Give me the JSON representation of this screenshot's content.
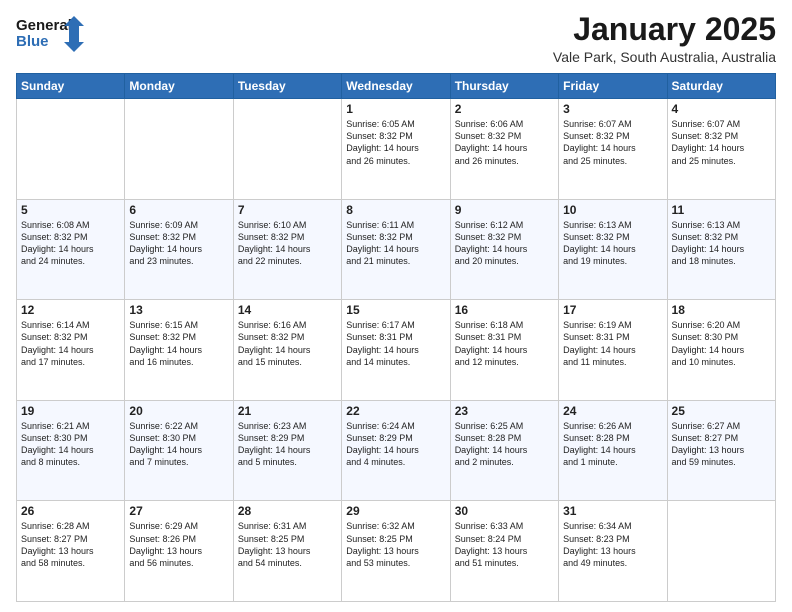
{
  "header": {
    "logo_line1": "General",
    "logo_line2": "Blue",
    "month": "January 2025",
    "location": "Vale Park, South Australia, Australia"
  },
  "days_of_week": [
    "Sunday",
    "Monday",
    "Tuesday",
    "Wednesday",
    "Thursday",
    "Friday",
    "Saturday"
  ],
  "weeks": [
    [
      {
        "day": "",
        "info": ""
      },
      {
        "day": "",
        "info": ""
      },
      {
        "day": "",
        "info": ""
      },
      {
        "day": "1",
        "info": "Sunrise: 6:05 AM\nSunset: 8:32 PM\nDaylight: 14 hours\nand 26 minutes."
      },
      {
        "day": "2",
        "info": "Sunrise: 6:06 AM\nSunset: 8:32 PM\nDaylight: 14 hours\nand 26 minutes."
      },
      {
        "day": "3",
        "info": "Sunrise: 6:07 AM\nSunset: 8:32 PM\nDaylight: 14 hours\nand 25 minutes."
      },
      {
        "day": "4",
        "info": "Sunrise: 6:07 AM\nSunset: 8:32 PM\nDaylight: 14 hours\nand 25 minutes."
      }
    ],
    [
      {
        "day": "5",
        "info": "Sunrise: 6:08 AM\nSunset: 8:32 PM\nDaylight: 14 hours\nand 24 minutes."
      },
      {
        "day": "6",
        "info": "Sunrise: 6:09 AM\nSunset: 8:32 PM\nDaylight: 14 hours\nand 23 minutes."
      },
      {
        "day": "7",
        "info": "Sunrise: 6:10 AM\nSunset: 8:32 PM\nDaylight: 14 hours\nand 22 minutes."
      },
      {
        "day": "8",
        "info": "Sunrise: 6:11 AM\nSunset: 8:32 PM\nDaylight: 14 hours\nand 21 minutes."
      },
      {
        "day": "9",
        "info": "Sunrise: 6:12 AM\nSunset: 8:32 PM\nDaylight: 14 hours\nand 20 minutes."
      },
      {
        "day": "10",
        "info": "Sunrise: 6:13 AM\nSunset: 8:32 PM\nDaylight: 14 hours\nand 19 minutes."
      },
      {
        "day": "11",
        "info": "Sunrise: 6:13 AM\nSunset: 8:32 PM\nDaylight: 14 hours\nand 18 minutes."
      }
    ],
    [
      {
        "day": "12",
        "info": "Sunrise: 6:14 AM\nSunset: 8:32 PM\nDaylight: 14 hours\nand 17 minutes."
      },
      {
        "day": "13",
        "info": "Sunrise: 6:15 AM\nSunset: 8:32 PM\nDaylight: 14 hours\nand 16 minutes."
      },
      {
        "day": "14",
        "info": "Sunrise: 6:16 AM\nSunset: 8:32 PM\nDaylight: 14 hours\nand 15 minutes."
      },
      {
        "day": "15",
        "info": "Sunrise: 6:17 AM\nSunset: 8:31 PM\nDaylight: 14 hours\nand 14 minutes."
      },
      {
        "day": "16",
        "info": "Sunrise: 6:18 AM\nSunset: 8:31 PM\nDaylight: 14 hours\nand 12 minutes."
      },
      {
        "day": "17",
        "info": "Sunrise: 6:19 AM\nSunset: 8:31 PM\nDaylight: 14 hours\nand 11 minutes."
      },
      {
        "day": "18",
        "info": "Sunrise: 6:20 AM\nSunset: 8:30 PM\nDaylight: 14 hours\nand 10 minutes."
      }
    ],
    [
      {
        "day": "19",
        "info": "Sunrise: 6:21 AM\nSunset: 8:30 PM\nDaylight: 14 hours\nand 8 minutes."
      },
      {
        "day": "20",
        "info": "Sunrise: 6:22 AM\nSunset: 8:30 PM\nDaylight: 14 hours\nand 7 minutes."
      },
      {
        "day": "21",
        "info": "Sunrise: 6:23 AM\nSunset: 8:29 PM\nDaylight: 14 hours\nand 5 minutes."
      },
      {
        "day": "22",
        "info": "Sunrise: 6:24 AM\nSunset: 8:29 PM\nDaylight: 14 hours\nand 4 minutes."
      },
      {
        "day": "23",
        "info": "Sunrise: 6:25 AM\nSunset: 8:28 PM\nDaylight: 14 hours\nand 2 minutes."
      },
      {
        "day": "24",
        "info": "Sunrise: 6:26 AM\nSunset: 8:28 PM\nDaylight: 14 hours\nand 1 minute."
      },
      {
        "day": "25",
        "info": "Sunrise: 6:27 AM\nSunset: 8:27 PM\nDaylight: 13 hours\nand 59 minutes."
      }
    ],
    [
      {
        "day": "26",
        "info": "Sunrise: 6:28 AM\nSunset: 8:27 PM\nDaylight: 13 hours\nand 58 minutes."
      },
      {
        "day": "27",
        "info": "Sunrise: 6:29 AM\nSunset: 8:26 PM\nDaylight: 13 hours\nand 56 minutes."
      },
      {
        "day": "28",
        "info": "Sunrise: 6:31 AM\nSunset: 8:25 PM\nDaylight: 13 hours\nand 54 minutes."
      },
      {
        "day": "29",
        "info": "Sunrise: 6:32 AM\nSunset: 8:25 PM\nDaylight: 13 hours\nand 53 minutes."
      },
      {
        "day": "30",
        "info": "Sunrise: 6:33 AM\nSunset: 8:24 PM\nDaylight: 13 hours\nand 51 minutes."
      },
      {
        "day": "31",
        "info": "Sunrise: 6:34 AM\nSunset: 8:23 PM\nDaylight: 13 hours\nand 49 minutes."
      },
      {
        "day": "",
        "info": ""
      }
    ]
  ]
}
